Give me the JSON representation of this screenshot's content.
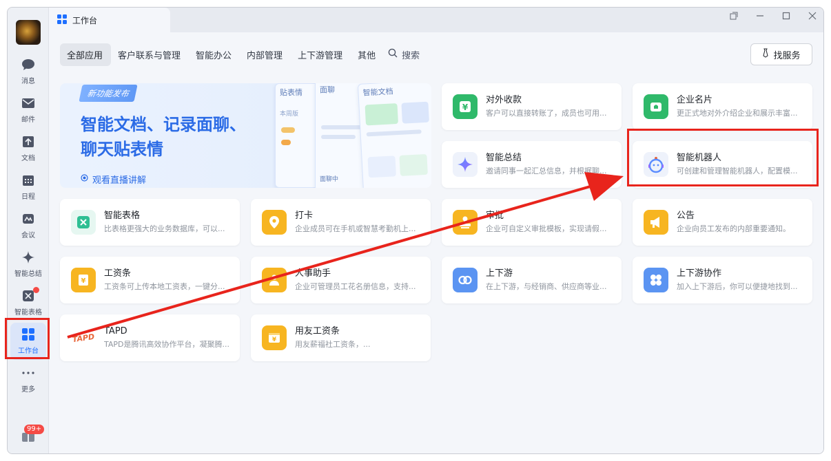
{
  "tab": {
    "title": "工作台"
  },
  "sidebar": {
    "items": [
      {
        "label": "消息"
      },
      {
        "label": "邮件"
      },
      {
        "label": "文档"
      },
      {
        "label": "日程"
      },
      {
        "label": "会议"
      },
      {
        "label": "智能总结"
      },
      {
        "label": "智能表格"
      },
      {
        "label": "工作台"
      },
      {
        "label": "更多"
      }
    ],
    "badge": "99+"
  },
  "categories": {
    "tabs": [
      "全部应用",
      "客户联系与管理",
      "智能办公",
      "内部管理",
      "上下游管理",
      "其他"
    ],
    "search_label": "搜索",
    "find_service": "找服务"
  },
  "banner": {
    "tag": "新功能发布",
    "title_line1": "智能文档、记录面聊、",
    "title_line2": "聊天贴表情",
    "link": "观看直播讲解",
    "mock1": "贴表情",
    "mock2": "面聊",
    "mock3": "智能文档",
    "mock4": "本周版",
    "mock5": "面聊中"
  },
  "apps": [
    {
      "title": "对外收款",
      "desc": "客户可以直接转账了，成员也可用...",
      "color": "#2fb96a",
      "icon": "yuan-icon"
    },
    {
      "title": "企业名片",
      "desc": "更正式地对外介绍企业和展示丰富...",
      "color": "#2fb96a",
      "icon": "card-icon"
    },
    {
      "title": "智能总结",
      "desc": "邀请同事一起汇总信息，并根据聊...",
      "color": "#eef2fb",
      "icon": "sparkle-icon"
    },
    {
      "title": "智能机器人",
      "desc": "可创建和管理智能机器人，配置模...",
      "color": "#eef2fb",
      "icon": "robot-icon"
    },
    {
      "title": "智能表格",
      "desc": "比表格更强大的业务数据库，可以...",
      "color": "#e6f7f1",
      "icon": "table-icon"
    },
    {
      "title": "打卡",
      "desc": "企业成员可在手机或智慧考勤机上...",
      "color": "#f7b521",
      "icon": "location-icon"
    },
    {
      "title": "审批",
      "desc": "企业可自定义审批模板，实现请假...",
      "color": "#f7b521",
      "icon": "stamp-icon"
    },
    {
      "title": "公告",
      "desc": "企业向员工发布的内部重要通知。",
      "color": "#f7b521",
      "icon": "megaphone-icon"
    },
    {
      "title": "工资条",
      "desc": "工资条可上传本地工资表，一键分...",
      "color": "#f7b521",
      "icon": "payslip-icon"
    },
    {
      "title": "人事助手",
      "desc": "企业可管理员工花名册信息，支持...",
      "color": "#f7b521",
      "icon": "person-icon"
    },
    {
      "title": "上下游",
      "desc": "在上下游，与经销商、供应商等业...",
      "color": "#5b94f2",
      "icon": "link-icon"
    },
    {
      "title": "上下游协作",
      "desc": "加入上下游后，你可以便捷地找到...",
      "color": "#5b94f2",
      "icon": "clover-icon"
    },
    {
      "title": "TAPD",
      "desc": "TAPD是腾讯高效协作平台，凝聚腾...",
      "color": "#ffffff",
      "icon": "tapd-logo-icon",
      "logo_text": "TAPD"
    },
    {
      "title": "用友工资条",
      "desc": "用友薪福社工资条，...",
      "color": "#f7b521",
      "icon": "yonyou-payslip-icon"
    }
  ]
}
